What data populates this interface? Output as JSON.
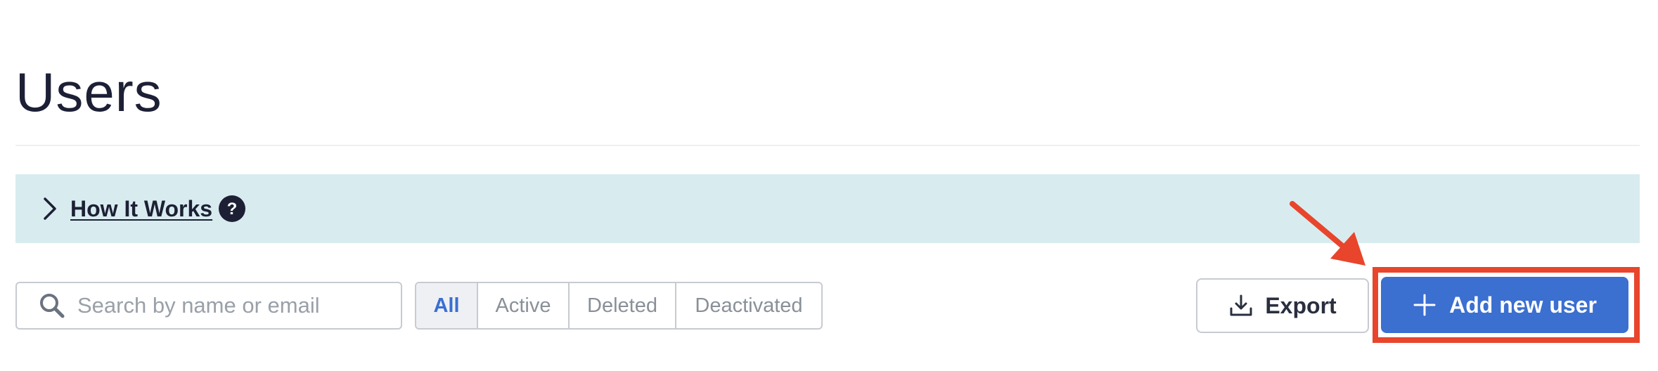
{
  "page": {
    "title": "Users"
  },
  "how_it_works": {
    "label": "How It Works",
    "chevron_icon": "chevron-right-icon",
    "help_icon": "question-circle-icon"
  },
  "search": {
    "placeholder": "Search by name or email",
    "value": "",
    "icon": "search-icon"
  },
  "filters": {
    "items": [
      {
        "label": "All",
        "selected": true
      },
      {
        "label": "Active",
        "selected": false
      },
      {
        "label": "Deleted",
        "selected": false
      },
      {
        "label": "Deactivated",
        "selected": false
      }
    ]
  },
  "actions": {
    "export_label": "Export",
    "export_icon": "download-icon",
    "add_user_label": "Add new user",
    "add_user_icon": "plus-icon"
  },
  "annotation": {
    "highlight_color": "#e8452c",
    "arrow_icon": "arrow-pointer"
  },
  "colors": {
    "primary": "#3b6fd0",
    "banner_bg": "#d8ecef",
    "title_text": "#1d2035"
  }
}
